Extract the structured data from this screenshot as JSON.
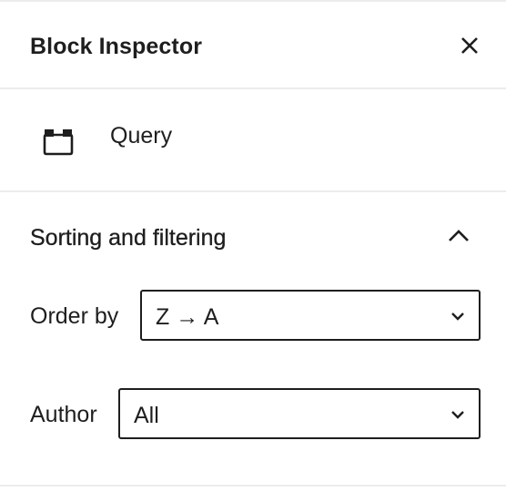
{
  "header": {
    "title": "Block Inspector",
    "close_icon": "close-icon"
  },
  "block": {
    "icon": "query-loop-icon",
    "name": "Query"
  },
  "section": {
    "title": "Sorting and filtering",
    "expanded": true,
    "toggle_icon": "chevron-up-icon"
  },
  "fields": {
    "order_by": {
      "label": "Order by",
      "value": "Z → A"
    },
    "author": {
      "label": "Author",
      "value": "All"
    }
  },
  "colors": {
    "text": "#1e1e1e",
    "divider": "#ececec",
    "background": "#ffffff"
  }
}
